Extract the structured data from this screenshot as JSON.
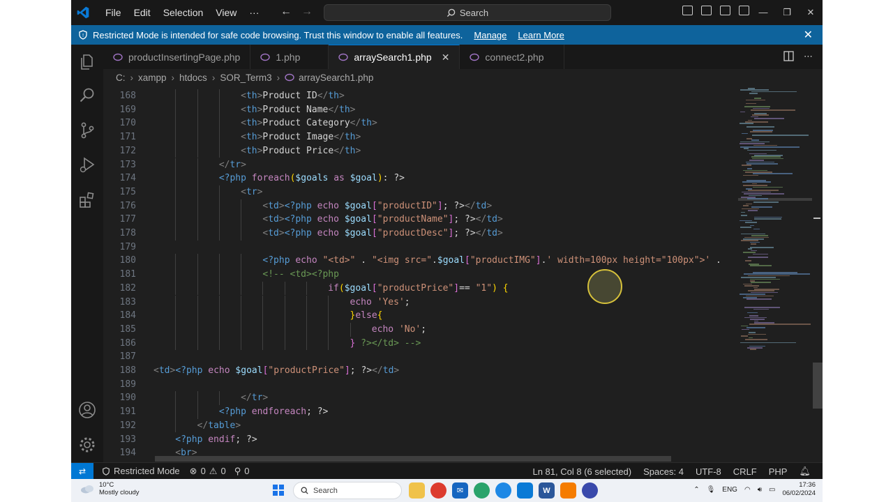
{
  "titlebar": {
    "menu": [
      "File",
      "Edit",
      "Selection",
      "View",
      "···"
    ],
    "search_label": "Search"
  },
  "banner": {
    "message": "Restricted Mode is intended for safe code browsing. Trust this window to enable all features.",
    "manage": "Manage",
    "learn_more": "Learn More"
  },
  "tabs": [
    {
      "label": "productInsertingPage.php",
      "active": false
    },
    {
      "label": "1.php",
      "active": false
    },
    {
      "label": "arraySearch1.php",
      "active": true
    },
    {
      "label": "connect2.php",
      "active": false
    }
  ],
  "breadcrumb": [
    "C:",
    "xampp",
    "htdocs",
    "SOR_Term3",
    "arraySearch1.php"
  ],
  "editor": {
    "line_numbers": [
      "168",
      "169",
      "170",
      "171",
      "172",
      "173",
      "174",
      "175",
      "176",
      "177",
      "178",
      "179",
      "180",
      "181",
      "182",
      "183",
      "184",
      "185",
      "186",
      "187",
      "188",
      "189",
      "190",
      "191",
      "192",
      "193",
      "194"
    ],
    "lines": [
      "<th>Product ID</th>",
      "<th>Product Name</th>",
      "<th>Product Category</th>",
      "<th>Product Image</th>",
      "<th>Product Price</th>",
      "</tr>",
      "<?php foreach($goals as $goal): ?>",
      "<tr>",
      "<td><?php echo $goal[\"productID\"]; ?></td>",
      "<td><?php echo $goal[\"productName\"]; ?></td>",
      "<td><?php echo $goal[\"productDesc\"]; ?></td>",
      "",
      "<?php echo \"<td>\" . \"<img src=\".$goal[\"productIMG\"].' width=100px height=\"100px\">' .",
      "<!-- <td><?php",
      "if($goal[\"productPrice\"]== \"1\") {",
      "echo 'Yes';",
      "}else{",
      "echo 'No';",
      "} ?></td> -->",
      "",
      "<td><?php echo $goal[\"productPrice\"]; ?></td>",
      "",
      "</tr>",
      "<?php endforeach; ?>",
      "</table>",
      "<?php endif; ?>",
      "<br>"
    ]
  },
  "status": {
    "restricted": "Restricted Mode",
    "problems": "0",
    "warnings": "0",
    "ports": "0",
    "position": "Ln 81, Col 8 (6 selected)",
    "spaces": "Spaces: 4",
    "encoding": "UTF-8",
    "eol": "CRLF",
    "language": "PHP"
  },
  "taskbar": {
    "temp": "10°C",
    "weather": "Mostly cloudy",
    "search": "Search",
    "lang": "ENG",
    "time": "17:36",
    "date": "06/02/2024"
  },
  "colors": {
    "accent": "#0078d4",
    "banner": "#0e639c",
    "editor_bg": "#1f1f1f"
  }
}
